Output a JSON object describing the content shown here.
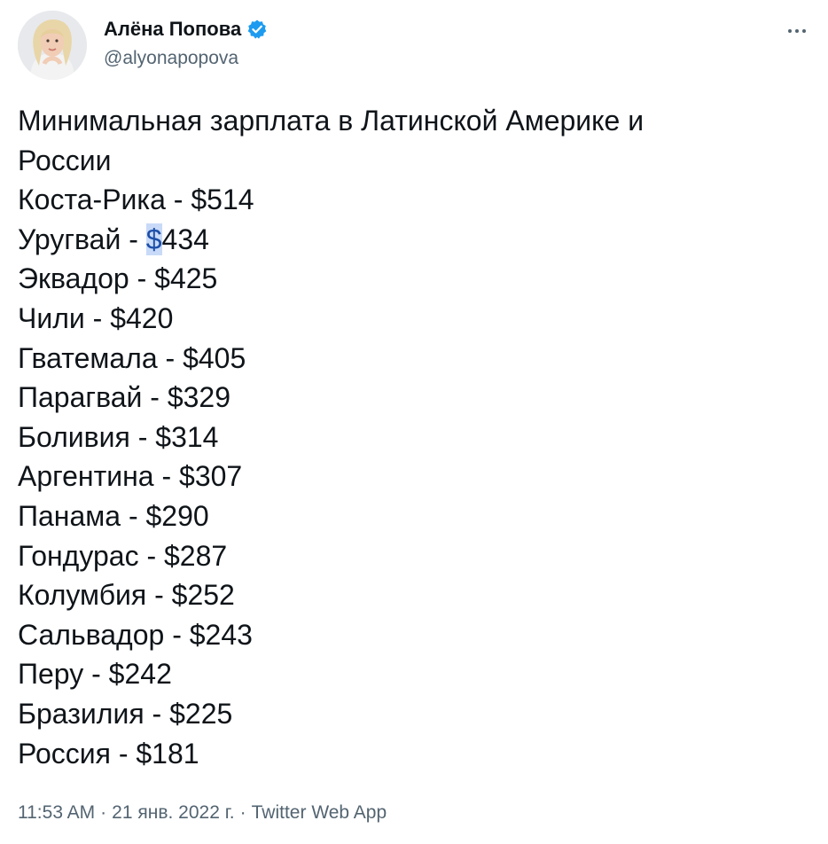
{
  "author": {
    "display_name": "Алёна Попова",
    "handle": "@alyonapopova",
    "verified": true
  },
  "tweet": {
    "title_lines": [
      "Минимальная зарплата в Латинской Америке и",
      "России"
    ],
    "wages": [
      {
        "country": "Коста-Рика",
        "amount": "$514"
      },
      {
        "country": "Уругвай",
        "amount": "$434"
      },
      {
        "country": "Эквадор",
        "amount": "$425"
      },
      {
        "country": "Чили",
        "amount": "$420"
      },
      {
        "country": "Гватемала",
        "amount": "$405"
      },
      {
        "country": "Парагвай",
        "amount": "$329"
      },
      {
        "country": "Боливия",
        "amount": "$314"
      },
      {
        "country": "Аргентина",
        "amount": "$307"
      },
      {
        "country": "Панама",
        "amount": "$290"
      },
      {
        "country": "Гондурас",
        "amount": "$287"
      },
      {
        "country": "Колумбия",
        "amount": "$252"
      },
      {
        "country": "Сальвадор",
        "amount": "$243"
      },
      {
        "country": "Перу",
        "amount": "$242"
      },
      {
        "country": "Бразилия",
        "amount": "$225"
      },
      {
        "country": "Россия",
        "amount": "$181"
      }
    ],
    "separator": " - "
  },
  "meta": {
    "time": "11:53 AM",
    "date": "21 янв. 2022 г.",
    "source": "Twitter Web App",
    "dot": "·"
  },
  "colors": {
    "text": "#0f1419",
    "secondary": "#536471",
    "verified_badge": "#1d9bf0",
    "selection": "#c8daf8"
  },
  "icons": {
    "verified": "verified-badge-icon",
    "more": "more-horizontal-icon"
  }
}
